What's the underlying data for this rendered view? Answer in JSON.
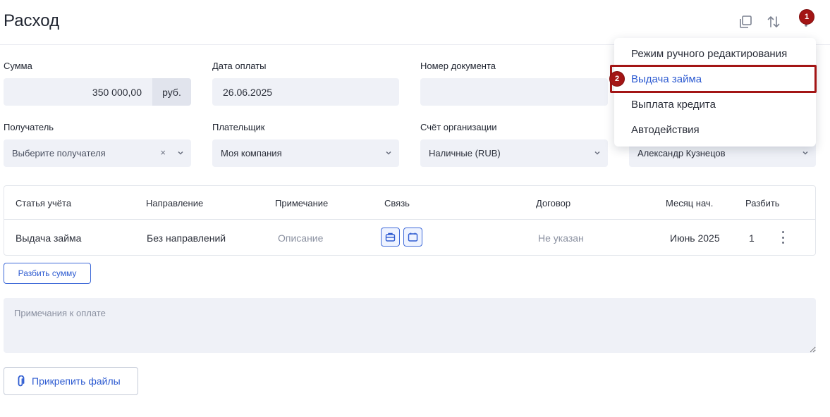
{
  "header": {
    "title": "Расход",
    "copy_icon": "copy-icon",
    "sort_icon": "sort-arrows-icon",
    "step_badge_1": "1"
  },
  "form": {
    "amount": {
      "label": "Сумма",
      "value": "350 000,00",
      "unit": "руб."
    },
    "payment_date": {
      "label": "Дата оплаты",
      "value": "26.06.2025"
    },
    "doc_number": {
      "label": "Номер документа",
      "value": ""
    },
    "recipient": {
      "label": "Получатель",
      "placeholder": "Выберите получателя",
      "clear": "×"
    },
    "payer": {
      "label": "Плательщик",
      "value": "Моя компания"
    },
    "org_account": {
      "label": "Счёт организации",
      "value": "Наличные (RUB)"
    },
    "responsible": {
      "value": "Александр Кузнецов"
    }
  },
  "table": {
    "headers": [
      "Статья учёта",
      "Направление",
      "Примечание",
      "Связь",
      "Договор",
      "Месяц нач.",
      "Разбить"
    ],
    "row": {
      "account": "Выдача займа",
      "direction": "Без направлений",
      "note": "Описание",
      "contract": "Не указан",
      "month": "Июнь 2025",
      "split": "1"
    }
  },
  "split_button": "Разбить сумму",
  "notes_placeholder": "Примечания к оплате",
  "attach_button": "Прикрепить файлы",
  "menu": {
    "items": [
      "Режим ручного редактирования",
      "Выдача займа",
      "Выплата кредита",
      "Автодействия"
    ],
    "step_badge_2": "2"
  },
  "colors": {
    "accent": "#2d5bd1",
    "badge": "#a31515",
    "field_bg": "#eff1f7"
  }
}
